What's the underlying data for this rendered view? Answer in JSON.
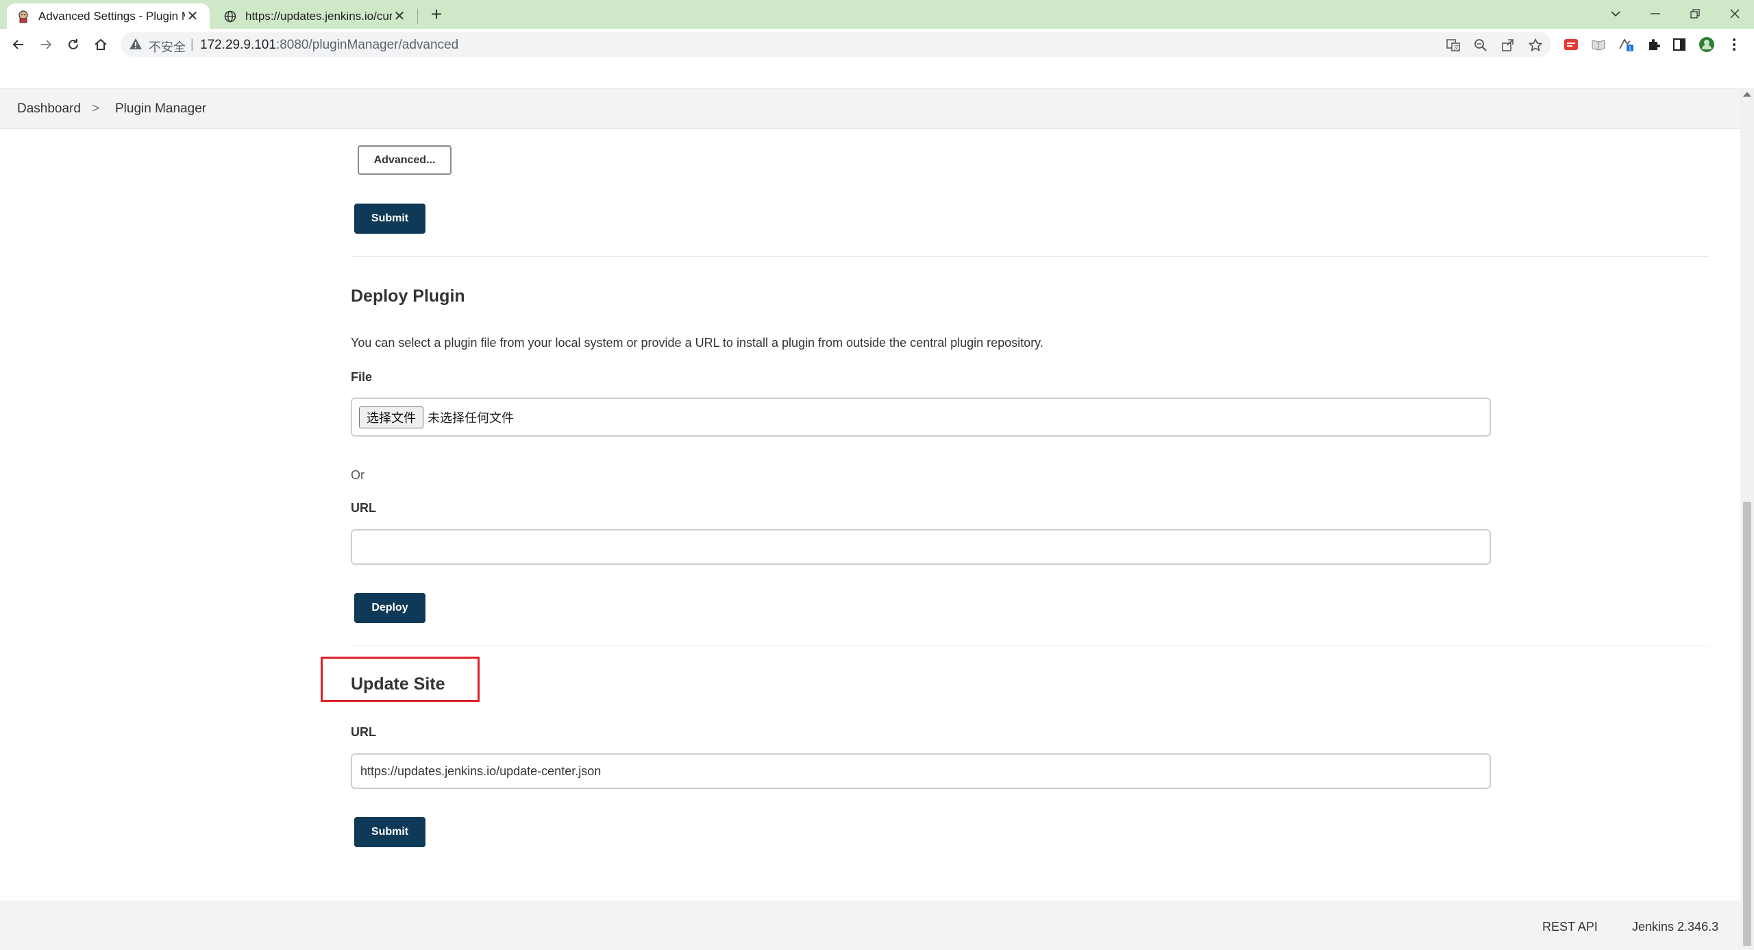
{
  "browser": {
    "tabs": [
      {
        "title": "Advanced Settings - Plugin M",
        "active": true
      },
      {
        "title": "https://updates.jenkins.io/curr",
        "active": false
      }
    ],
    "address": {
      "insecure_label": "不安全",
      "host": "172.29.9.101",
      "path": ":8080/pluginManager/advanced"
    }
  },
  "breadcrumb": {
    "items": [
      "Dashboard",
      "Plugin Manager"
    ],
    "separator": ">"
  },
  "proxy_section": {
    "advanced_label": "Advanced...",
    "submit_label": "Submit"
  },
  "deploy_plugin": {
    "title": "Deploy Plugin",
    "description": "You can select a plugin file from your local system or provide a URL to install a plugin from outside the central plugin repository.",
    "file_label": "File",
    "file_button": "选择文件",
    "file_status": "未选择任何文件",
    "or_label": "Or",
    "url_label": "URL",
    "url_value": "",
    "deploy_label": "Deploy"
  },
  "update_site": {
    "title": "Update Site",
    "url_label": "URL",
    "url_value": "https://updates.jenkins.io/update-center.json",
    "submit_label": "Submit"
  },
  "footer": {
    "rest_api": "REST API",
    "version": "Jenkins 2.346.3"
  },
  "colors": {
    "primary_button": "#0f3a57",
    "highlight_box": "#e0202a",
    "tabstrip": "#cfe8c8"
  }
}
